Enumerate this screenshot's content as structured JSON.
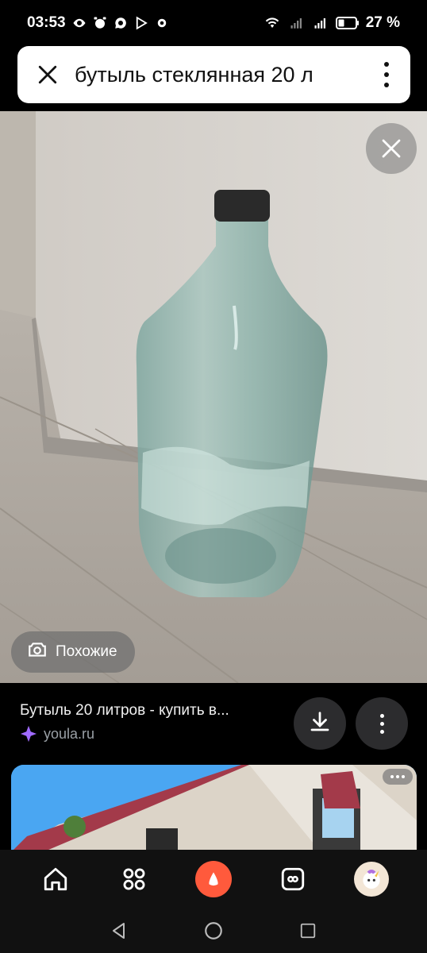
{
  "status_bar": {
    "time": "03:53",
    "battery": "27 %",
    "icons_left": [
      "eye-icon",
      "alarm-icon",
      "chat-icon",
      "play-icon",
      "settings-icon"
    ],
    "icons_right": [
      "wifi-icon",
      "signal-icon",
      "signal-icon",
      "battery-icon"
    ]
  },
  "search": {
    "query": "бутыль стеклянная 20 л",
    "close_icon": "close-icon",
    "menu_icon": "more-vertical-icon"
  },
  "viewer": {
    "close_icon": "close-icon",
    "similar_label": "Похожие",
    "similar_icon": "camera-lens-icon"
  },
  "result": {
    "title": "Бутыль 20 литров - купить в...",
    "source": "youla.ru",
    "download_icon": "download-icon",
    "more_icon": "more-vertical-icon"
  },
  "bottom_nav": {
    "items": [
      "home-icon",
      "apps-grid-icon",
      "alice-icon",
      "tabs-icon",
      "profile-avatar"
    ]
  },
  "system_nav": [
    "back-icon",
    "home-circle-icon",
    "recents-icon"
  ],
  "colors": {
    "background": "#000000",
    "alice_accent": "#ff5a3c",
    "source_text": "#9aa0a6"
  }
}
